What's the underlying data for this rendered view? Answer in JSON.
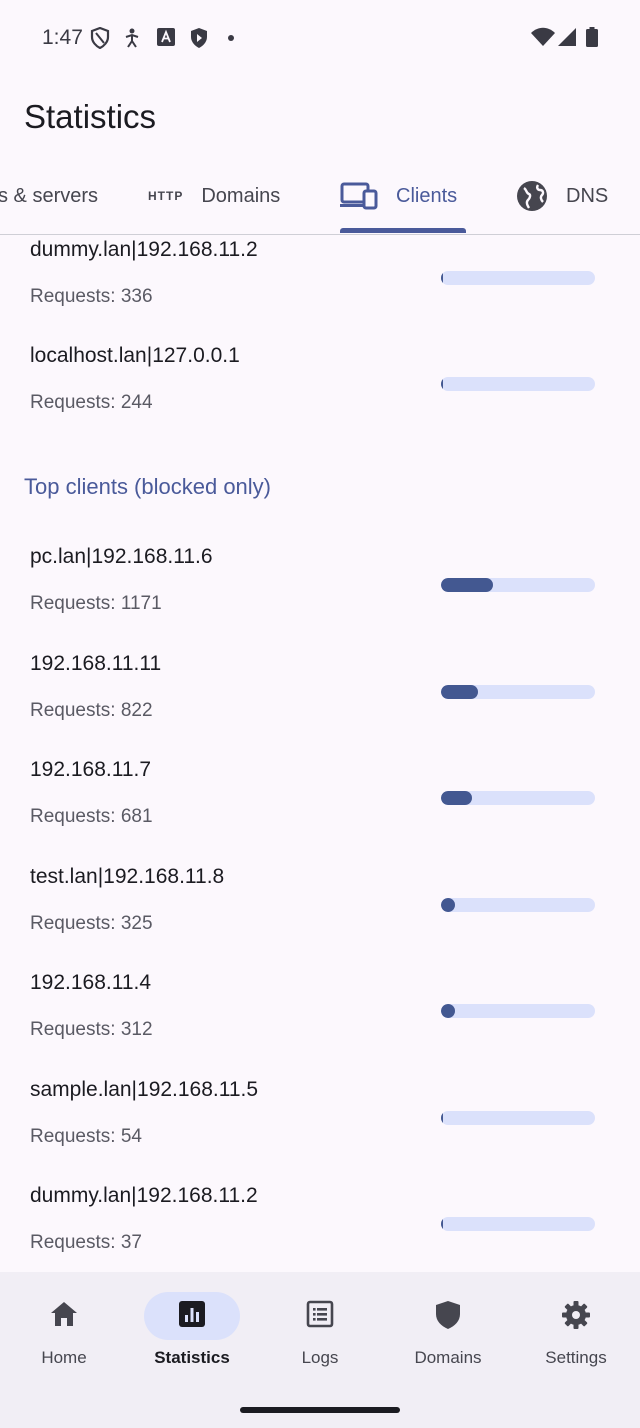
{
  "status_bar": {
    "time": "1:47"
  },
  "app_bar": {
    "title": "Statistics"
  },
  "tabs": [
    {
      "label": "s & servers",
      "icon": "dns-server-icon"
    },
    {
      "label": "Domains",
      "icon": "http-icon",
      "icon_text": "HTTP"
    },
    {
      "label": "Clients",
      "icon": "devices-icon",
      "active": true
    },
    {
      "label": "DNS",
      "icon": "globe-icon"
    }
  ],
  "top_clients_tail": [
    {
      "name": "dummy.lan|192.168.11.2",
      "requests": "Requests: 336",
      "fraction": 0.0
    },
    {
      "name": "localhost.lan|127.0.0.1",
      "requests": "Requests: 244",
      "fraction": 0.0
    }
  ],
  "blocked_section": {
    "title": "Top clients (blocked only)",
    "items": [
      {
        "name": "pc.lan|192.168.11.6",
        "requests": "Requests: 1171",
        "fraction": 0.34
      },
      {
        "name": "192.168.11.11",
        "requests": "Requests: 822",
        "fraction": 0.24
      },
      {
        "name": "192.168.11.7",
        "requests": "Requests: 681",
        "fraction": 0.2
      },
      {
        "name": "test.lan|192.168.11.8",
        "requests": "Requests: 325",
        "fraction": 0.09
      },
      {
        "name": "192.168.11.4",
        "requests": "Requests: 312",
        "fraction": 0.09
      },
      {
        "name": "sample.lan|192.168.11.5",
        "requests": "Requests: 54",
        "fraction": 0.015
      },
      {
        "name": "dummy.lan|192.168.11.2",
        "requests": "Requests: 37",
        "fraction": 0.01
      }
    ]
  },
  "bottom_nav": [
    {
      "label": "Home",
      "icon": "home-icon"
    },
    {
      "label": "Statistics",
      "icon": "statistics-icon",
      "active": true
    },
    {
      "label": "Logs",
      "icon": "logs-icon"
    },
    {
      "label": "Domains",
      "icon": "shield-icon"
    },
    {
      "label": "Settings",
      "icon": "gear-icon"
    }
  ],
  "colors": {
    "accent": "#4a5a9a",
    "bar_fill": "#435891",
    "bar_track": "#dbe1fb",
    "background": "#fcf8fd",
    "nav_background": "#f1eef5"
  }
}
